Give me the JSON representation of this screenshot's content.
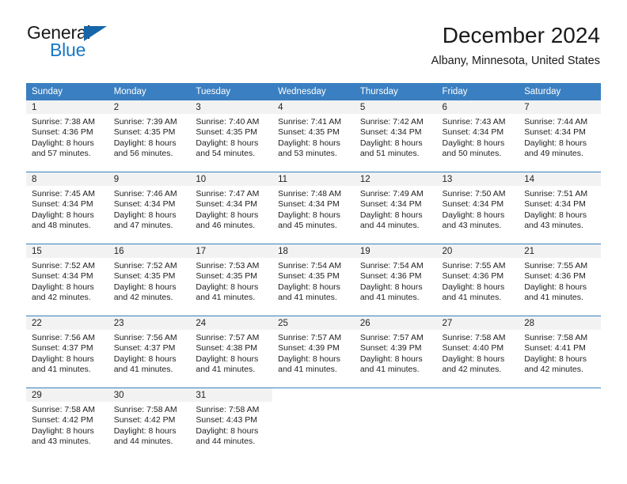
{
  "brand": {
    "word1": "General",
    "word2": "Blue",
    "flag_icon": "triangle-flag-icon",
    "accent_color": "#1877c4",
    "flag_color": "#1565a8"
  },
  "header": {
    "title": "December 2024",
    "subtitle": "Albany, Minnesota, United States"
  },
  "calendar": {
    "header_bg": "#3a7fc1",
    "daynum_bg": "#f2f2f2",
    "separator_color": "#3a7fc1",
    "weekday_headers": [
      "Sunday",
      "Monday",
      "Tuesday",
      "Wednesday",
      "Thursday",
      "Friday",
      "Saturday"
    ],
    "weeks": [
      [
        {
          "day": "1",
          "sunrise": "Sunrise: 7:38 AM",
          "sunset": "Sunset: 4:36 PM",
          "daylight_1": "Daylight: 8 hours",
          "daylight_2": "and 57 minutes."
        },
        {
          "day": "2",
          "sunrise": "Sunrise: 7:39 AM",
          "sunset": "Sunset: 4:35 PM",
          "daylight_1": "Daylight: 8 hours",
          "daylight_2": "and 56 minutes."
        },
        {
          "day": "3",
          "sunrise": "Sunrise: 7:40 AM",
          "sunset": "Sunset: 4:35 PM",
          "daylight_1": "Daylight: 8 hours",
          "daylight_2": "and 54 minutes."
        },
        {
          "day": "4",
          "sunrise": "Sunrise: 7:41 AM",
          "sunset": "Sunset: 4:35 PM",
          "daylight_1": "Daylight: 8 hours",
          "daylight_2": "and 53 minutes."
        },
        {
          "day": "5",
          "sunrise": "Sunrise: 7:42 AM",
          "sunset": "Sunset: 4:34 PM",
          "daylight_1": "Daylight: 8 hours",
          "daylight_2": "and 51 minutes."
        },
        {
          "day": "6",
          "sunrise": "Sunrise: 7:43 AM",
          "sunset": "Sunset: 4:34 PM",
          "daylight_1": "Daylight: 8 hours",
          "daylight_2": "and 50 minutes."
        },
        {
          "day": "7",
          "sunrise": "Sunrise: 7:44 AM",
          "sunset": "Sunset: 4:34 PM",
          "daylight_1": "Daylight: 8 hours",
          "daylight_2": "and 49 minutes."
        }
      ],
      [
        {
          "day": "8",
          "sunrise": "Sunrise: 7:45 AM",
          "sunset": "Sunset: 4:34 PM",
          "daylight_1": "Daylight: 8 hours",
          "daylight_2": "and 48 minutes."
        },
        {
          "day": "9",
          "sunrise": "Sunrise: 7:46 AM",
          "sunset": "Sunset: 4:34 PM",
          "daylight_1": "Daylight: 8 hours",
          "daylight_2": "and 47 minutes."
        },
        {
          "day": "10",
          "sunrise": "Sunrise: 7:47 AM",
          "sunset": "Sunset: 4:34 PM",
          "daylight_1": "Daylight: 8 hours",
          "daylight_2": "and 46 minutes."
        },
        {
          "day": "11",
          "sunrise": "Sunrise: 7:48 AM",
          "sunset": "Sunset: 4:34 PM",
          "daylight_1": "Daylight: 8 hours",
          "daylight_2": "and 45 minutes."
        },
        {
          "day": "12",
          "sunrise": "Sunrise: 7:49 AM",
          "sunset": "Sunset: 4:34 PM",
          "daylight_1": "Daylight: 8 hours",
          "daylight_2": "and 44 minutes."
        },
        {
          "day": "13",
          "sunrise": "Sunrise: 7:50 AM",
          "sunset": "Sunset: 4:34 PM",
          "daylight_1": "Daylight: 8 hours",
          "daylight_2": "and 43 minutes."
        },
        {
          "day": "14",
          "sunrise": "Sunrise: 7:51 AM",
          "sunset": "Sunset: 4:34 PM",
          "daylight_1": "Daylight: 8 hours",
          "daylight_2": "and 43 minutes."
        }
      ],
      [
        {
          "day": "15",
          "sunrise": "Sunrise: 7:52 AM",
          "sunset": "Sunset: 4:34 PM",
          "daylight_1": "Daylight: 8 hours",
          "daylight_2": "and 42 minutes."
        },
        {
          "day": "16",
          "sunrise": "Sunrise: 7:52 AM",
          "sunset": "Sunset: 4:35 PM",
          "daylight_1": "Daylight: 8 hours",
          "daylight_2": "and 42 minutes."
        },
        {
          "day": "17",
          "sunrise": "Sunrise: 7:53 AM",
          "sunset": "Sunset: 4:35 PM",
          "daylight_1": "Daylight: 8 hours",
          "daylight_2": "and 41 minutes."
        },
        {
          "day": "18",
          "sunrise": "Sunrise: 7:54 AM",
          "sunset": "Sunset: 4:35 PM",
          "daylight_1": "Daylight: 8 hours",
          "daylight_2": "and 41 minutes."
        },
        {
          "day": "19",
          "sunrise": "Sunrise: 7:54 AM",
          "sunset": "Sunset: 4:36 PM",
          "daylight_1": "Daylight: 8 hours",
          "daylight_2": "and 41 minutes."
        },
        {
          "day": "20",
          "sunrise": "Sunrise: 7:55 AM",
          "sunset": "Sunset: 4:36 PM",
          "daylight_1": "Daylight: 8 hours",
          "daylight_2": "and 41 minutes."
        },
        {
          "day": "21",
          "sunrise": "Sunrise: 7:55 AM",
          "sunset": "Sunset: 4:36 PM",
          "daylight_1": "Daylight: 8 hours",
          "daylight_2": "and 41 minutes."
        }
      ],
      [
        {
          "day": "22",
          "sunrise": "Sunrise: 7:56 AM",
          "sunset": "Sunset: 4:37 PM",
          "daylight_1": "Daylight: 8 hours",
          "daylight_2": "and 41 minutes."
        },
        {
          "day": "23",
          "sunrise": "Sunrise: 7:56 AM",
          "sunset": "Sunset: 4:37 PM",
          "daylight_1": "Daylight: 8 hours",
          "daylight_2": "and 41 minutes."
        },
        {
          "day": "24",
          "sunrise": "Sunrise: 7:57 AM",
          "sunset": "Sunset: 4:38 PM",
          "daylight_1": "Daylight: 8 hours",
          "daylight_2": "and 41 minutes."
        },
        {
          "day": "25",
          "sunrise": "Sunrise: 7:57 AM",
          "sunset": "Sunset: 4:39 PM",
          "daylight_1": "Daylight: 8 hours",
          "daylight_2": "and 41 minutes."
        },
        {
          "day": "26",
          "sunrise": "Sunrise: 7:57 AM",
          "sunset": "Sunset: 4:39 PM",
          "daylight_1": "Daylight: 8 hours",
          "daylight_2": "and 41 minutes."
        },
        {
          "day": "27",
          "sunrise": "Sunrise: 7:58 AM",
          "sunset": "Sunset: 4:40 PM",
          "daylight_1": "Daylight: 8 hours",
          "daylight_2": "and 42 minutes."
        },
        {
          "day": "28",
          "sunrise": "Sunrise: 7:58 AM",
          "sunset": "Sunset: 4:41 PM",
          "daylight_1": "Daylight: 8 hours",
          "daylight_2": "and 42 minutes."
        }
      ],
      [
        {
          "day": "29",
          "sunrise": "Sunrise: 7:58 AM",
          "sunset": "Sunset: 4:42 PM",
          "daylight_1": "Daylight: 8 hours",
          "daylight_2": "and 43 minutes."
        },
        {
          "day": "30",
          "sunrise": "Sunrise: 7:58 AM",
          "sunset": "Sunset: 4:42 PM",
          "daylight_1": "Daylight: 8 hours",
          "daylight_2": "and 44 minutes."
        },
        {
          "day": "31",
          "sunrise": "Sunrise: 7:58 AM",
          "sunset": "Sunset: 4:43 PM",
          "daylight_1": "Daylight: 8 hours",
          "daylight_2": "and 44 minutes."
        },
        {
          "day": "",
          "sunrise": "",
          "sunset": "",
          "daylight_1": "",
          "daylight_2": ""
        },
        {
          "day": "",
          "sunrise": "",
          "sunset": "",
          "daylight_1": "",
          "daylight_2": ""
        },
        {
          "day": "",
          "sunrise": "",
          "sunset": "",
          "daylight_1": "",
          "daylight_2": ""
        },
        {
          "day": "",
          "sunrise": "",
          "sunset": "",
          "daylight_1": "",
          "daylight_2": ""
        }
      ]
    ]
  }
}
